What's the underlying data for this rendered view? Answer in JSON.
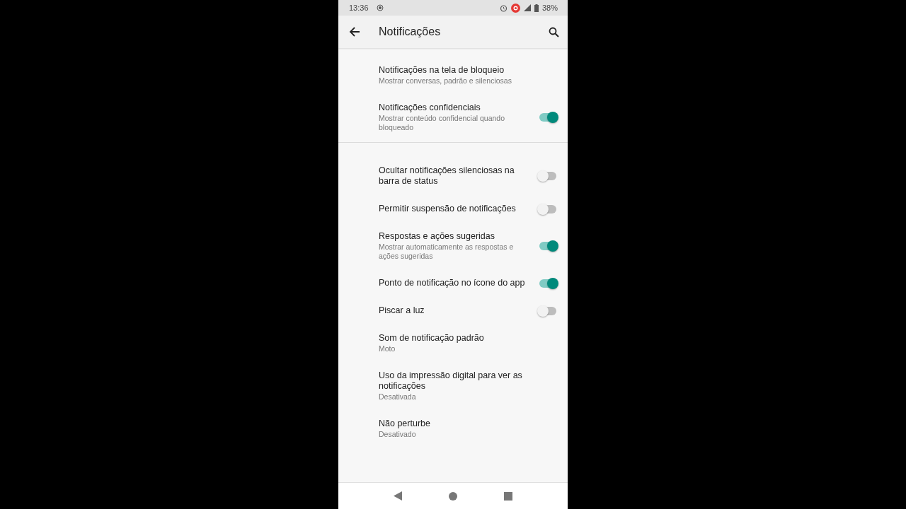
{
  "status_bar": {
    "time": "13:36",
    "battery": "38%"
  },
  "toolbar": {
    "title": "Notificações"
  },
  "sections": [
    {
      "items": [
        {
          "kind": "plain",
          "title": "Notificações na tela de bloqueio",
          "summary": "Mostrar conversas, padrão e silenciosas"
        },
        {
          "kind": "toggle",
          "title": "Notificações confidenciais",
          "summary": "Mostrar conteúdo confidencial quando bloqueado",
          "on": true
        }
      ]
    },
    {
      "items": [
        {
          "kind": "toggle",
          "title": "Ocultar notificações silenciosas na barra de status",
          "on": false
        },
        {
          "kind": "toggle",
          "title": "Permitir suspensão de notificações",
          "on": false
        },
        {
          "kind": "toggle",
          "title": "Respostas e ações sugeridas",
          "summary": "Mostrar automaticamente as respostas e ações sugeridas",
          "on": true
        },
        {
          "kind": "toggle",
          "title": "Ponto de notificação no ícone do app",
          "on": true
        },
        {
          "kind": "toggle",
          "title": "Piscar a luz",
          "on": false
        },
        {
          "kind": "plain",
          "title": "Som de notificação padrão",
          "summary": "Moto"
        },
        {
          "kind": "plain",
          "title": "Uso da impressão digital para ver as notificações",
          "summary": "Desativada"
        },
        {
          "kind": "plain",
          "title": "Não perturbe",
          "summary": "Desativado"
        }
      ]
    }
  ]
}
